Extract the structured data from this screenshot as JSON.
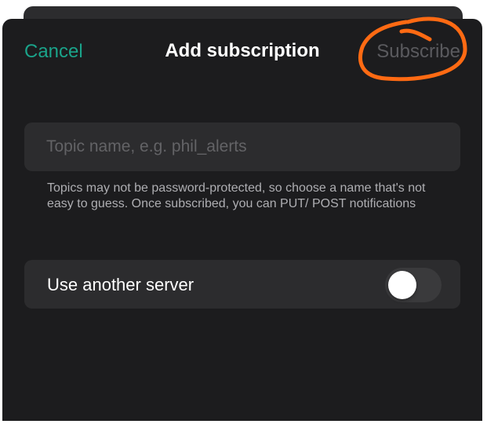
{
  "nav": {
    "cancel_label": "Cancel",
    "title": "Add subscription",
    "subscribe_label": "Subscribe"
  },
  "topic": {
    "value": "",
    "placeholder": "Topic name, e.g. phil_alerts"
  },
  "helper_text": "Topics may not be password-protected, so choose a name that's not easy to guess. Once subscribed, you can PUT/ POST notifications",
  "server": {
    "label": "Use another server",
    "enabled": false
  },
  "colors": {
    "accent": "#1aa38a",
    "disabled": "#5a5a5e",
    "annotation": "#ff6a13",
    "background": "#1c1c1e",
    "field": "#2c2c2e"
  }
}
